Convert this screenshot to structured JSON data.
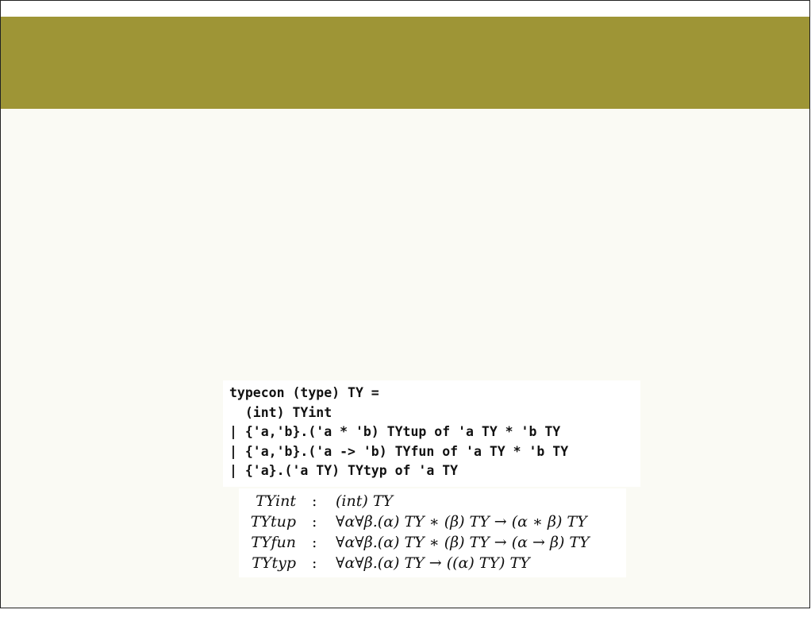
{
  "colors": {
    "header_band": "#9e9536",
    "slide_background": "#fafaf4"
  },
  "code": {
    "lines": [
      "typecon (type) TY =",
      "  (int) TYint",
      "| {'a,'b}.('a * 'b) TYtup of 'a TY * 'b TY",
      "| {'a,'b}.('a -> 'b) TYfun of 'a TY * 'b TY",
      "| {'a}.('a TY) TYtyp of 'a TY"
    ]
  },
  "types": [
    {
      "name": "TYint",
      "sep": ":",
      "sig": "(int) TY"
    },
    {
      "name": "TYtup",
      "sep": ":",
      "sig": "∀α∀β.(α) TY ∗ (β) TY → (α ∗ β) TY"
    },
    {
      "name": "TYfun",
      "sep": ":",
      "sig": "∀α∀β.(α) TY ∗ (β) TY → (α → β) TY"
    },
    {
      "name": "TYtyp",
      "sep": ":",
      "sig": "∀α∀β.(α) TY → ((α) TY) TY"
    }
  ]
}
